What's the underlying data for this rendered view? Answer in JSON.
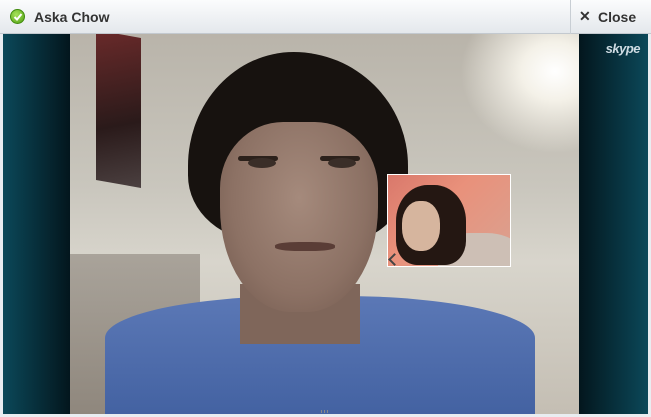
{
  "window": {
    "title": "Aska Chow",
    "status_icon": "online-check-icon"
  },
  "toolbar": {
    "close_label": "Close",
    "close_icon": "close-icon"
  },
  "video": {
    "watermark": "skype"
  },
  "colors": {
    "title_text": "#333333",
    "status_green": "#4f9f12"
  }
}
